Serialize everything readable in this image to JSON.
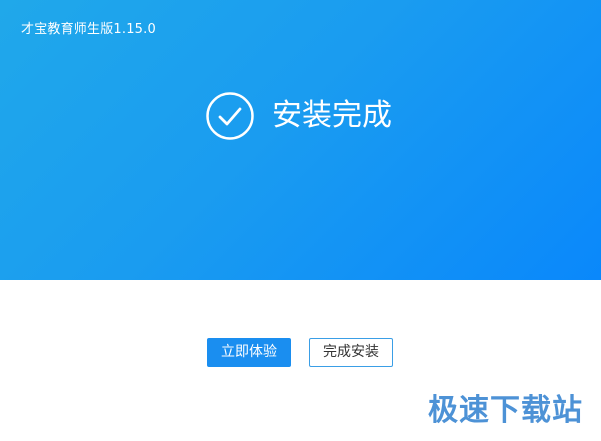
{
  "window": {
    "title": "才宝教育师生版1.15.0"
  },
  "status": {
    "icon": "check-circle-icon",
    "text": "安装完成"
  },
  "actions": {
    "primary_label": "立即体验",
    "secondary_label": "完成安装"
  },
  "watermark": {
    "text": "极速下载站"
  },
  "colors": {
    "header_gradient_start": "#20a8ea",
    "header_gradient_end": "#0a88fb",
    "primary_button": "#1a8ef0",
    "secondary_border": "#3a9ee6"
  }
}
